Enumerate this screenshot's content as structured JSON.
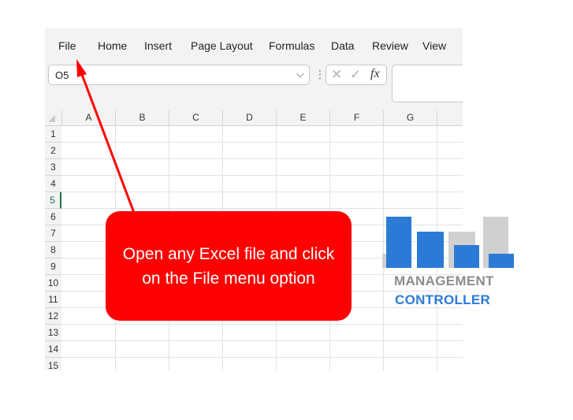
{
  "menu": [
    "File",
    "Home",
    "Insert",
    "Page Layout",
    "Formulas",
    "Data",
    "Review",
    "View"
  ],
  "name_box": {
    "value": "O5"
  },
  "formula_bar": {
    "cancel": "✕",
    "enter": "✓",
    "fx": "fx"
  },
  "columns": [
    "A",
    "B",
    "C",
    "D",
    "E",
    "F",
    "G"
  ],
  "rows": [
    "1",
    "2",
    "3",
    "4",
    "5",
    "6",
    "7",
    "8",
    "9",
    "10",
    "11",
    "12",
    "13",
    "14",
    "15"
  ],
  "active_row": "5",
  "callout": {
    "text": "Open any Excel file and click on the File menu option",
    "color": "#ff0000"
  },
  "logo": {
    "line1": "MANAGEMENT",
    "line2": "CONTROLLER",
    "blue": "#2b7bd6",
    "gray": "#8c8c8c"
  }
}
